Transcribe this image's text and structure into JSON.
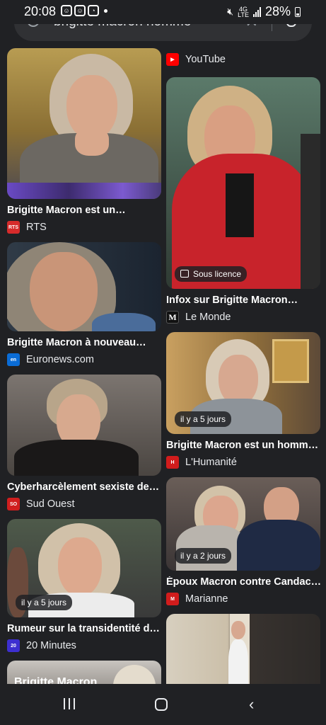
{
  "status": {
    "time": "20:08",
    "battery": "28%",
    "network": "4G LTE"
  },
  "search": {
    "query": "brigitte macron homme"
  },
  "results_left": [
    {
      "title": "Brigitte Macron est un…",
      "source": "RTS",
      "badge": "",
      "favicon_color": "#d62b2b",
      "favicon_text": "RTS"
    },
    {
      "title": "Brigitte Macron à nouveau…",
      "source": "Euronews.com",
      "badge": "",
      "favicon_color": "#0a6cd6",
      "favicon_text": "en"
    },
    {
      "title": "Cyberharcèlement sexiste de…",
      "source": "Sud Ouest",
      "badge": "",
      "favicon_color": "#d01e1e",
      "favicon_text": "SO"
    },
    {
      "title": "Rumeur sur la transidentité d…",
      "source": "20 Minutes",
      "badge": "il y a 5 jours",
      "favicon_color": "#3d2fd0",
      "favicon_text": "20"
    },
    {
      "title": "",
      "source": "",
      "badge": "",
      "overlay_text": "Brigitte Macron"
    }
  ],
  "results_right": [
    {
      "title": "Infox sur Brigitte Macron…",
      "source": "Le Monde",
      "badge": "Sous licence",
      "favicon_color": "#111111",
      "favicon_text": "M"
    },
    {
      "title": "Brigitte Macron est un homm…",
      "source": "L'Humanité",
      "badge": "il y a 5 jours",
      "favicon_color": "#d11c1c",
      "favicon_text": "H"
    },
    {
      "title": "Époux Macron contre Candac…",
      "source": "Marianne",
      "badge": "il y a 2 jours",
      "favicon_color": "#d11c1c",
      "favicon_text": "M"
    }
  ],
  "youtube": {
    "label": "YouTube",
    "color": "#ff0000"
  },
  "icons": [
    "search-icon",
    "clear-icon",
    "mic-icon",
    "youtube-icon",
    "image-icon",
    "recents-icon",
    "home-icon",
    "back-icon"
  ]
}
